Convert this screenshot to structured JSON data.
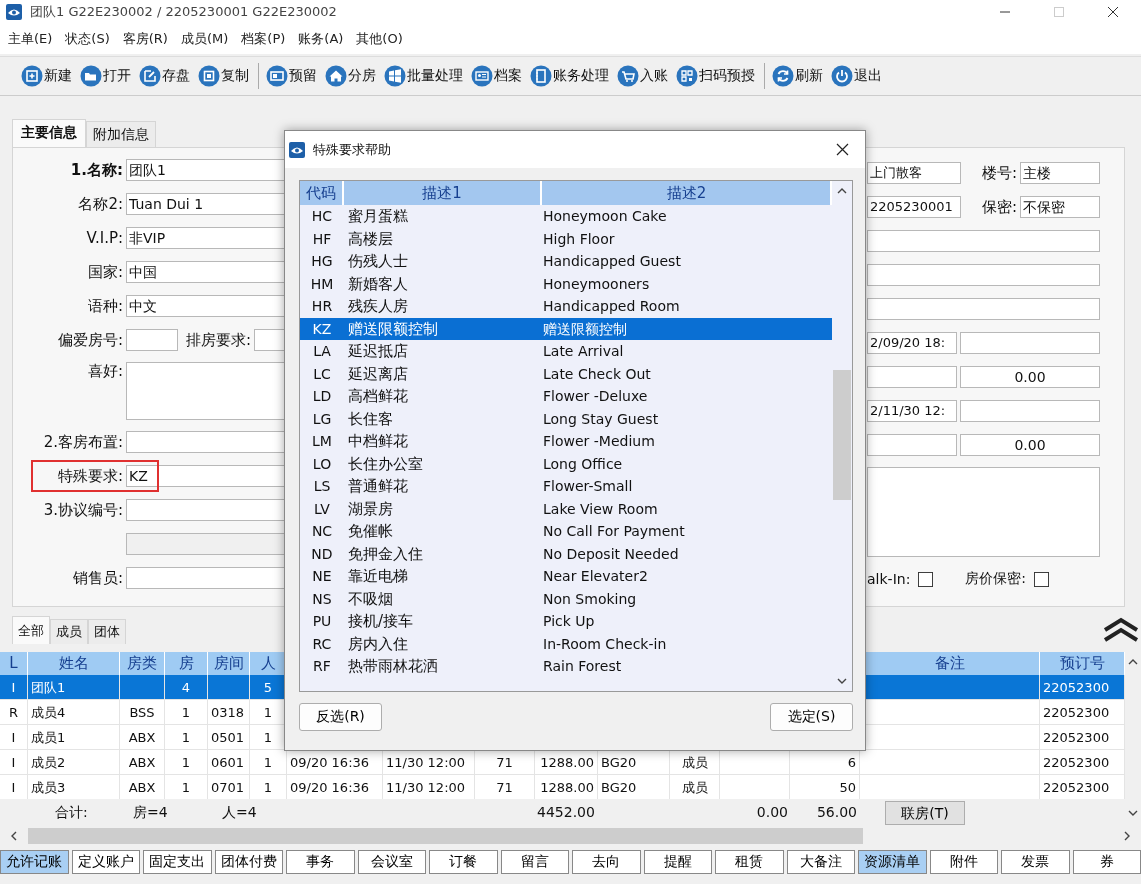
{
  "window": {
    "title": "团队1 G22E230002 / 2205230001 G22E230002"
  },
  "menu": [
    "主单(E)",
    "状态(S)",
    "客房(R)",
    "成员(M)",
    "档案(P)",
    "账务(A)",
    "其他(O)"
  ],
  "toolbar": [
    [
      "新建",
      "打开",
      "存盘",
      "复制"
    ],
    [
      "预留",
      "分房",
      "批量处理",
      "档案",
      "账务处理",
      "入账",
      "扫码预授"
    ],
    [
      "刷新",
      "退出"
    ]
  ],
  "tabs": [
    {
      "label": "主要信息",
      "selected": true
    },
    {
      "label": "附加信息",
      "selected": false
    }
  ],
  "form_left": [
    {
      "kind": "primary",
      "label": "1.名称:",
      "value": "团队1"
    },
    {
      "kind": "field",
      "label": "名称2:",
      "value": "Tuan Dui 1"
    },
    {
      "kind": "field",
      "label": "V.I.P:",
      "value": "非VIP"
    },
    {
      "kind": "field",
      "label": "国家:",
      "value": "中国"
    },
    {
      "kind": "field",
      "label": "语种:",
      "value": "中文"
    },
    {
      "kind": "pair",
      "label": "偏爱房号:",
      "label2": "排房要求:"
    },
    {
      "kind": "area",
      "label": "喜好:"
    },
    {
      "kind": "field",
      "label": "2.客房布置:"
    },
    {
      "kind": "flagged",
      "label": "特殊要求:",
      "value": "KZ"
    },
    {
      "kind": "field",
      "label": "3.协议编号:"
    },
    {
      "kind": "blank"
    },
    {
      "kind": "field",
      "label": "销售员:"
    }
  ],
  "form_right": [
    {
      "kind": "pair",
      "value": "上门散客",
      "label": "楼号:",
      "value2": "主楼"
    },
    {
      "kind": "pair",
      "value": "2205230001",
      "label": "保密:",
      "value2": "不保密"
    },
    {
      "kind": "field"
    },
    {
      "kind": "field"
    },
    {
      "kind": "field"
    },
    {
      "kind": "split",
      "value": "2/09/20 18:"
    },
    {
      "kind": "split",
      "value2": "0.00"
    },
    {
      "kind": "split",
      "value": "2/11/30 12:"
    },
    {
      "kind": "split",
      "value2": "0.00"
    },
    {
      "kind": "area"
    },
    {
      "kind": "checks",
      "items": [
        {
          "label": "alk-In:",
          "checked": false
        },
        {
          "label": "房价保密:",
          "checked": false
        }
      ]
    }
  ],
  "list_tabs": [
    {
      "label": "全部",
      "selected": true
    },
    {
      "label": "成员",
      "selected": false
    },
    {
      "label": "团体",
      "selected": false
    }
  ],
  "table": {
    "header": {
      "l": "L",
      "name": "姓名",
      "room_type": "房类",
      "rooms": "房",
      "room": "房间",
      "persons": "人",
      "remarks": "备注",
      "booking_no": "预订号"
    },
    "rows": [
      {
        "selected": true,
        "l": "I",
        "name": "团队1",
        "rooms": "4",
        "persons": "5",
        "booking_no": "22052300"
      },
      {
        "selected": false,
        "l": "R",
        "name": "成员4",
        "room_type": "BSS",
        "rooms": "1",
        "room": "0318",
        "persons": "1",
        "booking_no": "22052300"
      },
      {
        "selected": false,
        "l": "I",
        "name": "成员1",
        "room_type": "ABX",
        "rooms": "1",
        "room": "0501",
        "persons": "1",
        "booking_no": "22052300"
      },
      {
        "selected": false,
        "l": "I",
        "name": "成员2",
        "room_type": "ABX",
        "rooms": "1",
        "room": "0601",
        "persons": "1",
        "column_7": "09/20 16:36",
        "column_8": "11/30 12:00",
        "column_9": "71",
        "column_10": "1288.00",
        "column_11": "BG20",
        "column_12": "成员",
        "column_14": "6",
        "booking_no": "22052300"
      },
      {
        "selected": false,
        "l": "I",
        "name": "成员3",
        "room_type": "ABX",
        "rooms": "1",
        "room": "0701",
        "persons": "1",
        "column_7": "09/20 16:36",
        "column_8": "11/30 12:00",
        "column_9": "71",
        "column_10": "1288.00",
        "column_11": "BG20",
        "column_12": "成员",
        "column_14": "50",
        "booking_no": "22052300"
      }
    ],
    "summary": {
      "label": "合计:",
      "rooms": "房=4",
      "persons": "人=4",
      "total": "4452.00",
      "column_13": "0.00",
      "column_14": "56.00",
      "button": "联房(T)"
    }
  },
  "bottom_buttons": [
    {
      "label": "允许记账",
      "highlighted": true
    },
    {
      "label": "定义账户",
      "highlighted": false
    },
    {
      "label": "固定支出",
      "highlighted": false
    },
    {
      "label": "团体付费",
      "highlighted": false
    },
    {
      "label": "事务",
      "highlighted": false
    },
    {
      "label": "会议室",
      "highlighted": false
    },
    {
      "label": "订餐",
      "highlighted": false
    },
    {
      "label": "留言",
      "highlighted": false
    },
    {
      "label": "去向",
      "highlighted": false
    },
    {
      "label": "提醒",
      "highlighted": false
    },
    {
      "label": "租赁",
      "highlighted": false
    },
    {
      "label": "大备注",
      "highlighted": false
    },
    {
      "label": "资源清单",
      "highlighted": true
    },
    {
      "label": "附件",
      "highlighted": false
    },
    {
      "label": "发票",
      "highlighted": false
    },
    {
      "label": "券",
      "highlighted": false
    }
  ],
  "dialog": {
    "title": "特殊要求帮助",
    "columns": [
      "代码",
      "描述1",
      "描述2"
    ],
    "rows": [
      {
        "code": "HC",
        "desc1": "蜜月蛋糕",
        "desc2": "Honeymoon Cake",
        "selected": false
      },
      {
        "code": "HF",
        "desc1": "高楼层",
        "desc2": "High Floor",
        "selected": false
      },
      {
        "code": "HG",
        "desc1": "伤残人士",
        "desc2": "Handicapped Guest",
        "selected": false
      },
      {
        "code": "HM",
        "desc1": "新婚客人",
        "desc2": "Honeymooners",
        "selected": false
      },
      {
        "code": "HR",
        "desc1": "残疾人房",
        "desc2": "Handicapped Room",
        "selected": false
      },
      {
        "code": "KZ",
        "desc1": "赠送限额控制",
        "desc2": "赠送限额控制",
        "selected": true
      },
      {
        "code": "LA",
        "desc1": "延迟抵店",
        "desc2": "Late Arrival",
        "selected": false
      },
      {
        "code": "LC",
        "desc1": "延迟离店",
        "desc2": "Late Check Out",
        "selected": false
      },
      {
        "code": "LD",
        "desc1": "高档鲜花",
        "desc2": "Flower -Deluxe",
        "selected": false
      },
      {
        "code": "LG",
        "desc1": "长住客",
        "desc2": "Long Stay Guest",
        "selected": false
      },
      {
        "code": "LM",
        "desc1": "中档鲜花",
        "desc2": "Flower -Medium",
        "selected": false
      },
      {
        "code": "LO",
        "desc1": "长住办公室",
        "desc2": "Long Office",
        "selected": false
      },
      {
        "code": "LS",
        "desc1": "普通鲜花",
        "desc2": "Flower-Small",
        "selected": false
      },
      {
        "code": "LV",
        "desc1": "湖景房",
        "desc2": "Lake View Room",
        "selected": false
      },
      {
        "code": "NC",
        "desc1": "免催帐",
        "desc2": "No Call For Payment",
        "selected": false
      },
      {
        "code": "ND",
        "desc1": "免押金入住",
        "desc2": "No Deposit Needed",
        "selected": false
      },
      {
        "code": "NE",
        "desc1": "靠近电梯",
        "desc2": "Near Elevater2",
        "selected": false
      },
      {
        "code": "NS",
        "desc1": "不吸烟",
        "desc2": "Non Smoking",
        "selected": false
      },
      {
        "code": "PU",
        "desc1": "接机/接车",
        "desc2": "Pick Up",
        "selected": false
      },
      {
        "code": "RC",
        "desc1": "房内入住",
        "desc2": "In-Room Check-in",
        "selected": false
      },
      {
        "code": "RF",
        "desc1": "热带雨林花洒",
        "desc2": "Rain Forest",
        "selected": false
      }
    ],
    "buttons": [
      "反选(R)",
      "选定(S)"
    ]
  }
}
